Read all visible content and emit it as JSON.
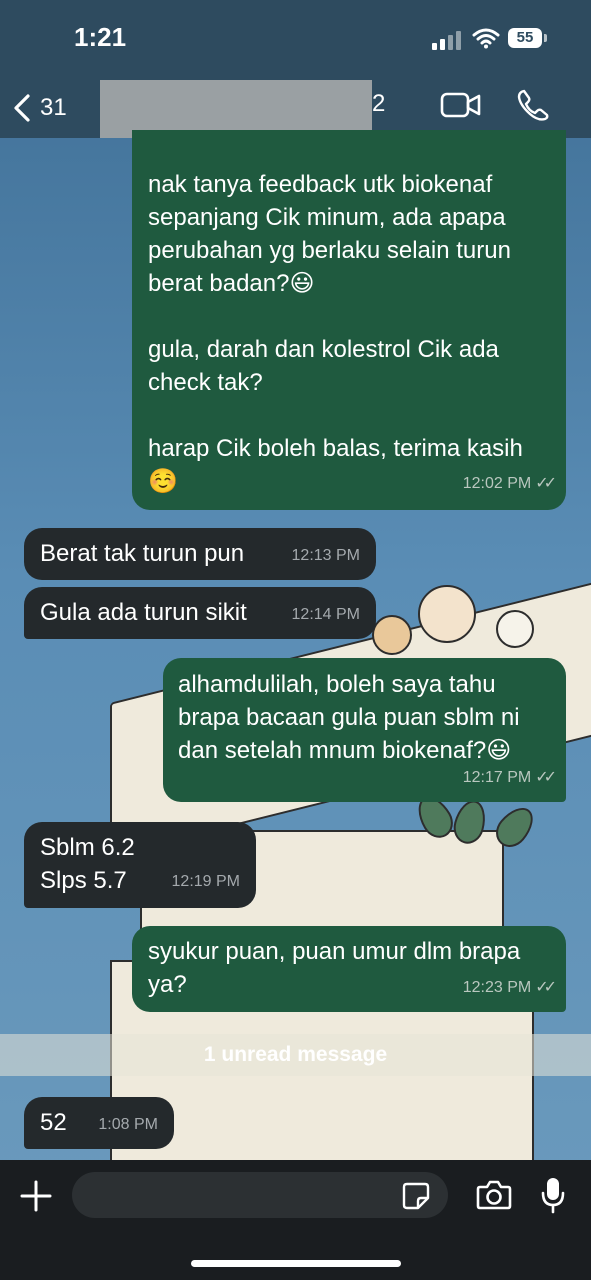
{
  "status": {
    "time": "1:21",
    "battery": "55"
  },
  "header": {
    "back_count": "31",
    "contact_suffix": "2"
  },
  "messages": [
    {
      "dir": "out",
      "text": "nak tanya feedback utk biokenaf\nsepanjang Cik minum, ada apapa\nperubahan yg berlaku selain turun\nberat badan?😃\n\ngula, darah dan kolestrol Cik ada\ncheck tak?\n\nharap Cik boleh balas, terima kasih\n☺️",
      "time": "12:02 PM"
    },
    {
      "dir": "in",
      "text": "Berat tak turun pun",
      "time": "12:13 PM"
    },
    {
      "dir": "in",
      "text": "Gula ada turun sikit",
      "time": "12:14 PM"
    },
    {
      "dir": "out",
      "text": "alhamdulilah, boleh saya tahu\nbrapa bacaan gula puan sblm ni\ndan setelah mnum biokenaf?😃",
      "time": "12:17 PM"
    },
    {
      "dir": "in",
      "text": "Sblm 6.2\nSlps 5.7",
      "time": "12:19 PM"
    },
    {
      "dir": "out",
      "text": "syukur puan, puan umur dlm brapa\nya?",
      "time": "12:23 PM"
    },
    {
      "dir": "in",
      "text": "52",
      "time": "1:08 PM"
    }
  ],
  "unread_banner": "1 unread message",
  "colors": {
    "outgoing": "#1f5a3f",
    "incoming": "#24292c",
    "header": "#2e4b5f"
  }
}
